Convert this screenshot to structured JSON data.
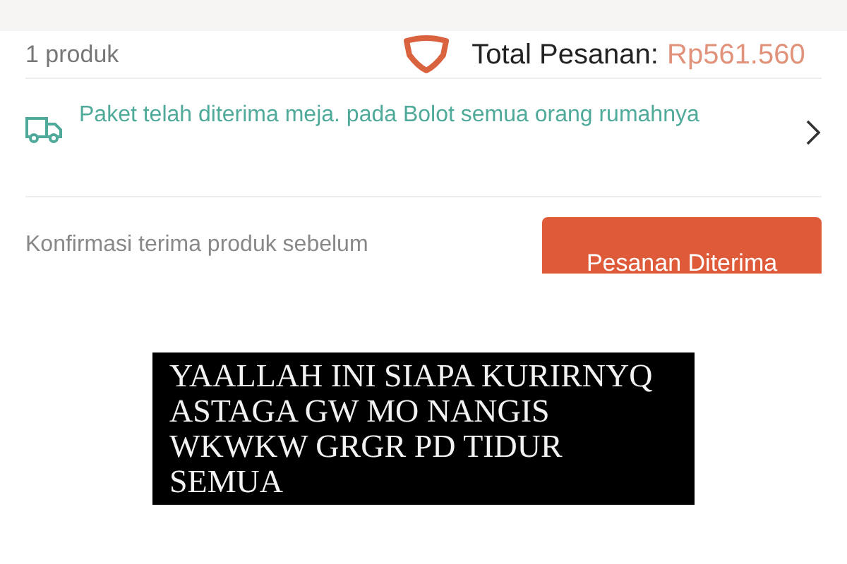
{
  "order_summary": {
    "count": "1 produk",
    "total_label": "Total Pesanan:",
    "total_value": "Rp561.560"
  },
  "delivery_status": {
    "text": "Paket telah diterima meja. pada Bolot semua orang rumahnya"
  },
  "confirmation": {
    "text": "Konfirmasi terima produk sebelum",
    "button": "Pesanan Diterima"
  },
  "caption": {
    "text": "YAALLAH INI SIAPA KURIRNYQ ASTAGA GW MO NANGIS WKWKW GRGR PD TIDUR SEMUA"
  }
}
